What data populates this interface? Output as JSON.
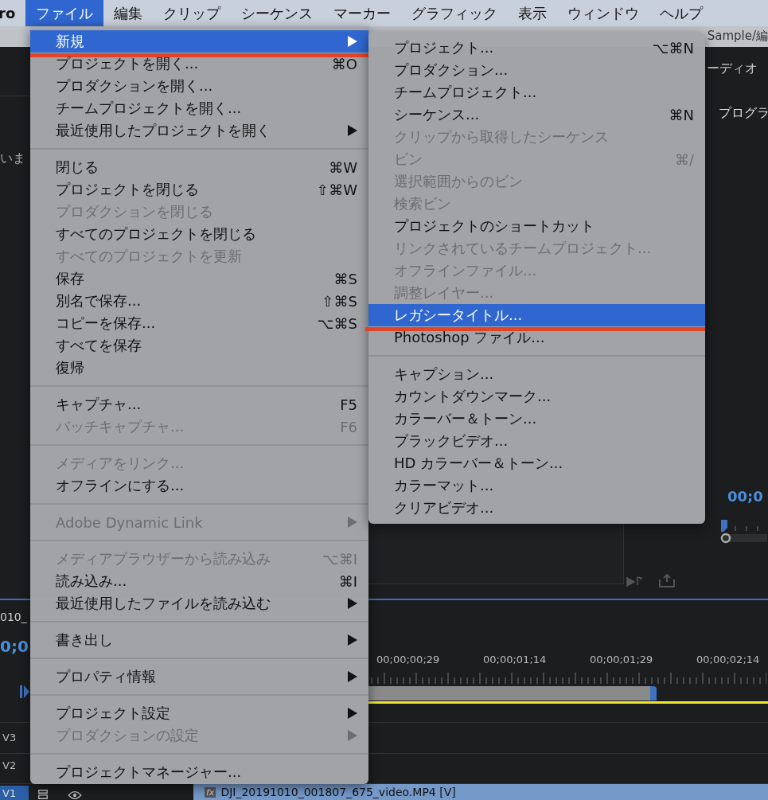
{
  "menubar": {
    "app_name": "ro",
    "items": [
      {
        "label": "ファイル",
        "selected": true
      },
      {
        "label": "編集",
        "selected": false
      },
      {
        "label": "クリップ",
        "selected": false
      },
      {
        "label": "シーケンス",
        "selected": false
      },
      {
        "label": "マーカー",
        "selected": false
      },
      {
        "label": "グラフィック",
        "selected": false
      },
      {
        "label": "表示",
        "selected": false
      },
      {
        "label": "ウィンドウ",
        "selected": false
      },
      {
        "label": "ヘルプ",
        "selected": false
      }
    ]
  },
  "file_menu": {
    "sections": [
      [
        {
          "label": "新規",
          "submenu": true,
          "disabled": false,
          "selected": true
        },
        {
          "label": "プロジェクトを開く...",
          "shortcut": "⌘O",
          "submenu": false,
          "disabled": false,
          "selected": false
        },
        {
          "label": "プロダクションを開く...",
          "submenu": false,
          "disabled": false,
          "selected": false
        },
        {
          "label": "チームプロジェクトを開く...",
          "submenu": false,
          "disabled": false,
          "selected": false
        },
        {
          "label": "最近使用したプロジェクトを開く",
          "submenu": true,
          "disabled": false,
          "selected": false
        }
      ],
      [
        {
          "label": "閉じる",
          "shortcut": "⌘W",
          "submenu": false,
          "disabled": false,
          "selected": false
        },
        {
          "label": "プロジェクトを閉じる",
          "shortcut": "⇧⌘W",
          "submenu": false,
          "disabled": false,
          "selected": false
        },
        {
          "label": "プロダクションを閉じる",
          "submenu": false,
          "disabled": true,
          "selected": false
        },
        {
          "label": "すべてのプロジェクトを閉じる",
          "submenu": false,
          "disabled": false,
          "selected": false
        },
        {
          "label": "すべてのプロジェクトを更新",
          "submenu": false,
          "disabled": true,
          "selected": false
        },
        {
          "label": "保存",
          "shortcut": "⌘S",
          "submenu": false,
          "disabled": false,
          "selected": false
        },
        {
          "label": "別名で保存...",
          "shortcut": "⇧⌘S",
          "submenu": false,
          "disabled": false,
          "selected": false
        },
        {
          "label": "コピーを保存...",
          "shortcut": "⌥⌘S",
          "submenu": false,
          "disabled": false,
          "selected": false
        },
        {
          "label": "すべてを保存",
          "submenu": false,
          "disabled": false,
          "selected": false
        },
        {
          "label": "復帰",
          "submenu": false,
          "disabled": false,
          "selected": false
        }
      ],
      [
        {
          "label": "キャプチャ...",
          "shortcut": "F5",
          "submenu": false,
          "disabled": false,
          "selected": false
        },
        {
          "label": "バッチキャプチャ...",
          "shortcut": "F6",
          "submenu": false,
          "disabled": true,
          "selected": false
        }
      ],
      [
        {
          "label": "メディアをリンク...",
          "submenu": false,
          "disabled": true,
          "selected": false
        },
        {
          "label": "オフラインにする...",
          "submenu": false,
          "disabled": false,
          "selected": false
        }
      ],
      [
        {
          "label": "Adobe Dynamic Link",
          "submenu": true,
          "disabled": true,
          "selected": false
        }
      ],
      [
        {
          "label": "メディアブラウザーから読み込み",
          "shortcut": "⌥⌘I",
          "submenu": false,
          "disabled": true,
          "selected": false
        },
        {
          "label": "読み込み...",
          "shortcut": "⌘I",
          "submenu": false,
          "disabled": false,
          "selected": false
        },
        {
          "label": "最近使用したファイルを読み込む",
          "submenu": true,
          "disabled": false,
          "selected": false
        }
      ],
      [
        {
          "label": "書き出し",
          "submenu": true,
          "disabled": false,
          "selected": false
        }
      ],
      [
        {
          "label": "プロパティ情報",
          "submenu": true,
          "disabled": false,
          "selected": false
        }
      ],
      [
        {
          "label": "プロジェクト設定",
          "submenu": true,
          "disabled": false,
          "selected": false
        },
        {
          "label": "プロダクションの設定",
          "submenu": true,
          "disabled": true,
          "selected": false
        }
      ],
      [
        {
          "label": "プロジェクトマネージャー...",
          "submenu": false,
          "disabled": false,
          "selected": false
        }
      ]
    ]
  },
  "new_submenu": {
    "sections": [
      [
        {
          "label": "プロジェクト...",
          "shortcut": "⌥⌘N",
          "disabled": false,
          "selected": false
        },
        {
          "label": "プロダクション...",
          "disabled": false,
          "selected": false
        },
        {
          "label": "チームプロジェクト...",
          "disabled": false,
          "selected": false
        },
        {
          "label": "シーケンス...",
          "shortcut": "⌘N",
          "disabled": false,
          "selected": false
        },
        {
          "label": "クリップから取得したシーケンス",
          "disabled": true,
          "selected": false
        },
        {
          "label": "ビン",
          "shortcut": "⌘/",
          "disabled": true,
          "selected": false
        },
        {
          "label": "選択範囲からのビン",
          "disabled": true,
          "selected": false
        },
        {
          "label": "検索ビン",
          "disabled": true,
          "selected": false
        },
        {
          "label": "プロジェクトのショートカット",
          "disabled": false,
          "selected": false
        },
        {
          "label": "リンクされているチームプロジェクト...",
          "disabled": true,
          "selected": false
        },
        {
          "label": "オフラインファイル...",
          "disabled": true,
          "selected": false
        },
        {
          "label": "調整レイヤー...",
          "disabled": true,
          "selected": false
        },
        {
          "label": "レガシータイトル...",
          "disabled": false,
          "selected": true
        },
        {
          "label": "Photoshop ファイル...",
          "disabled": false,
          "selected": false
        }
      ],
      [
        {
          "label": "キャプション...",
          "disabled": false,
          "selected": false
        },
        {
          "label": "カウントダウンマーク...",
          "disabled": false,
          "selected": false
        },
        {
          "label": "カラーバー＆トーン...",
          "disabled": false,
          "selected": false
        },
        {
          "label": "ブラックビデオ...",
          "disabled": false,
          "selected": false
        },
        {
          "label": "HD カラーバー＆トーン...",
          "disabled": false,
          "selected": false
        },
        {
          "label": "カラーマット...",
          "disabled": false,
          "selected": false
        },
        {
          "label": "クリアビデオ...",
          "disabled": false,
          "selected": false
        }
      ]
    ]
  },
  "background": {
    "path_fragment": "Sample/編",
    "panel_tab_fragment": "ーディオ",
    "project_panel_fragment": "いま",
    "program_monitor_title": "プログラ",
    "program_timecode": "00;0",
    "program_playhead": {
      "level": 0
    },
    "sequence_name_fragment": "010_",
    "sequence_timecode": "0;0",
    "tracks": [
      {
        "label": "V3",
        "selected": false
      },
      {
        "label": "V2",
        "selected": false
      },
      {
        "label": "V1",
        "selected": true
      }
    ],
    "ruler_labels": [
      "00;00;00;29",
      "00;00;01;14",
      "00;00;01;29",
      "00;00;02;14"
    ],
    "clip_badge": "fx",
    "clip_label": "DJI_20191010_001807_675_video.MP4 [V]"
  }
}
